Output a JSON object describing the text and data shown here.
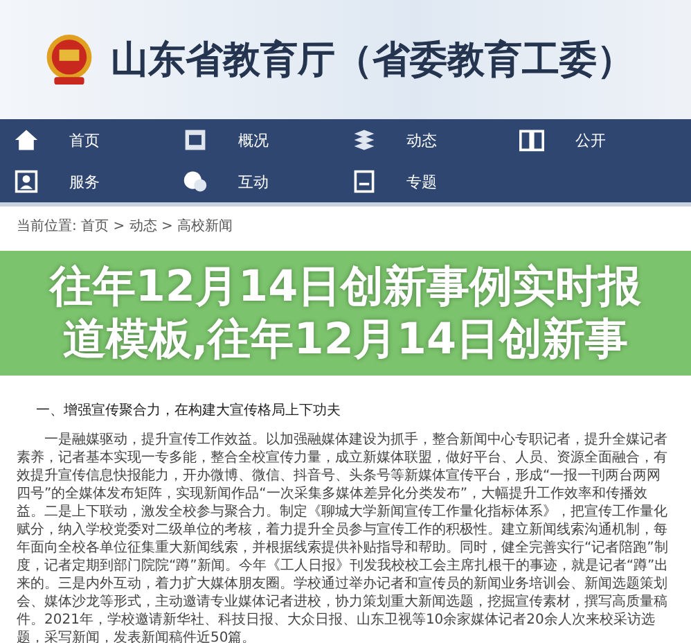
{
  "header": {
    "title": "山东省教育厅（省委教育工委）"
  },
  "nav": [
    {
      "label": "首页",
      "kind": "home"
    },
    {
      "label": "概况",
      "kind": "board"
    },
    {
      "label": "动态",
      "kind": "stack"
    },
    {
      "label": "公开",
      "kind": "book"
    },
    {
      "label": "服务",
      "kind": "person"
    },
    {
      "label": "互动",
      "kind": "chat"
    },
    {
      "label": "专题",
      "kind": "doc"
    }
  ],
  "breadcrumb": "当前位置: 首页 > 动态 > 高校新闻",
  "overlay": {
    "lines": [
      "往年12月14日创新事例实时报",
      "道模板,往年12月14日创新事"
    ]
  },
  "article": {
    "heading": "一、增强宣传聚合力，在构建大宣传格局上下功夫",
    "paragraph": "一是融媒驱动，提升宣传工作效益。以加强融媒体建设为抓手，整合新闻中心专职记者，提升全媒记者素养，记者基本实现一专多能，整合全校宣传力量，成立新媒体联盟，做好平台、人员、资源全面融合，有效提升宣传信息快报能力，开办微博、微信、抖音号、头条号等新媒体宣传平台，形成“一报一刊两台两网四号”的全媒体发布矩阵，实现新闻作品“一次采集多媒体差异化分类发布”，大幅提升工作效率和传播效益。二是上下联动，激发全校参与聚合力。制定《聊城大学新闻宣传工作量化指标体系》，把宣传工作量化赋分，纳入学校党委对二级单位的考核，着力提升全员参与宣传工作的积极性。建立新闻线索沟通机制，每年面向全校各单位征集重大新闻线索，并根据线索提供补贴指导和帮助。同时，健全完善实行“记者陪跑”制度，记者定期到部门院院“蹲”新闻。今年《工人日报》刊发我校校工会主席扎根干的事迹，就是记者“蹲”出来的。三是内外互动，着力扩大媒体朋友圈。学校通过举办记者和宣传员的新闻业务培训会、新闻选题策划会、媒体沙龙等形式，主动邀请专业媒体记者进校，协力策划重大新闻选题，挖掘宣传素材，撰写高质量稿件。2021年，学校邀请新华社、科技日报、大众日报、山东卫视等10余家媒体记者20余人次来校采访选题，采写新闻，发表新闻稿件近50篇。"
  }
}
